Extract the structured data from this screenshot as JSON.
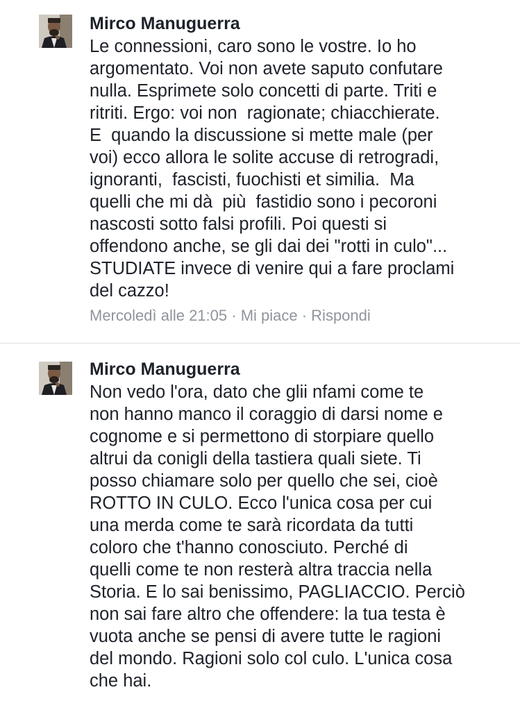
{
  "comments": [
    {
      "author": "Mirco Manuguerra",
      "lines": [
        "Le connessioni, caro sono le vostre. Io ho",
        "argomentato. Voi non avete saputo confutare",
        "nulla. Esprimete solo concetti di parte. Triti e",
        "ritriti. Ergo: voi non  ragionate; chiacchierate.",
        "E  quando la discussione si mette male (per",
        "voi) ecco allora le solite accuse di retrogradi,",
        "ignoranti,  fascisti, fuochisti et similia.  Ma",
        "quelli che mi dà  più  fastidio sono i pecoroni",
        "nascosti sotto falsi profili. Poi questi si",
        "offendono anche, se gli dai dei \"rotti in culo\"...",
        "STUDIATE invece di venire qui a fare proclami",
        "del cazzo!"
      ],
      "meta": {
        "time": "Mercoledì alle 21:05",
        "separator": " · ",
        "like": "Mi piace",
        "reply": "Rispondi"
      }
    },
    {
      "author": "Mirco Manuguerra",
      "lines": [
        "Non vedo l'ora, dato che glii nfami come te",
        "non hanno manco il coraggio di darsi nome e",
        "cognome e si permettono di storpiare quello",
        "altrui da conigli della tastiera quali siete. Ti",
        "posso chiamare solo per quello che sei, cioè",
        "ROTTO IN CULO. Ecco l'unica cosa per cui",
        "una merda come te sarà ricordata da tutti",
        "coloro che t'hanno conosciuto. Perché di",
        "quelli come te non resterà altra traccia nella",
        "Storia. E lo sai benissimo, PAGLIACCIO. Perciò",
        "non sai fare altro che offendere: la tua testa è",
        "vuota anche se pensi di avere tutte le ragioni",
        "del mondo. Ragioni solo col culo. L'unica cosa",
        "che hai."
      ]
    }
  ]
}
